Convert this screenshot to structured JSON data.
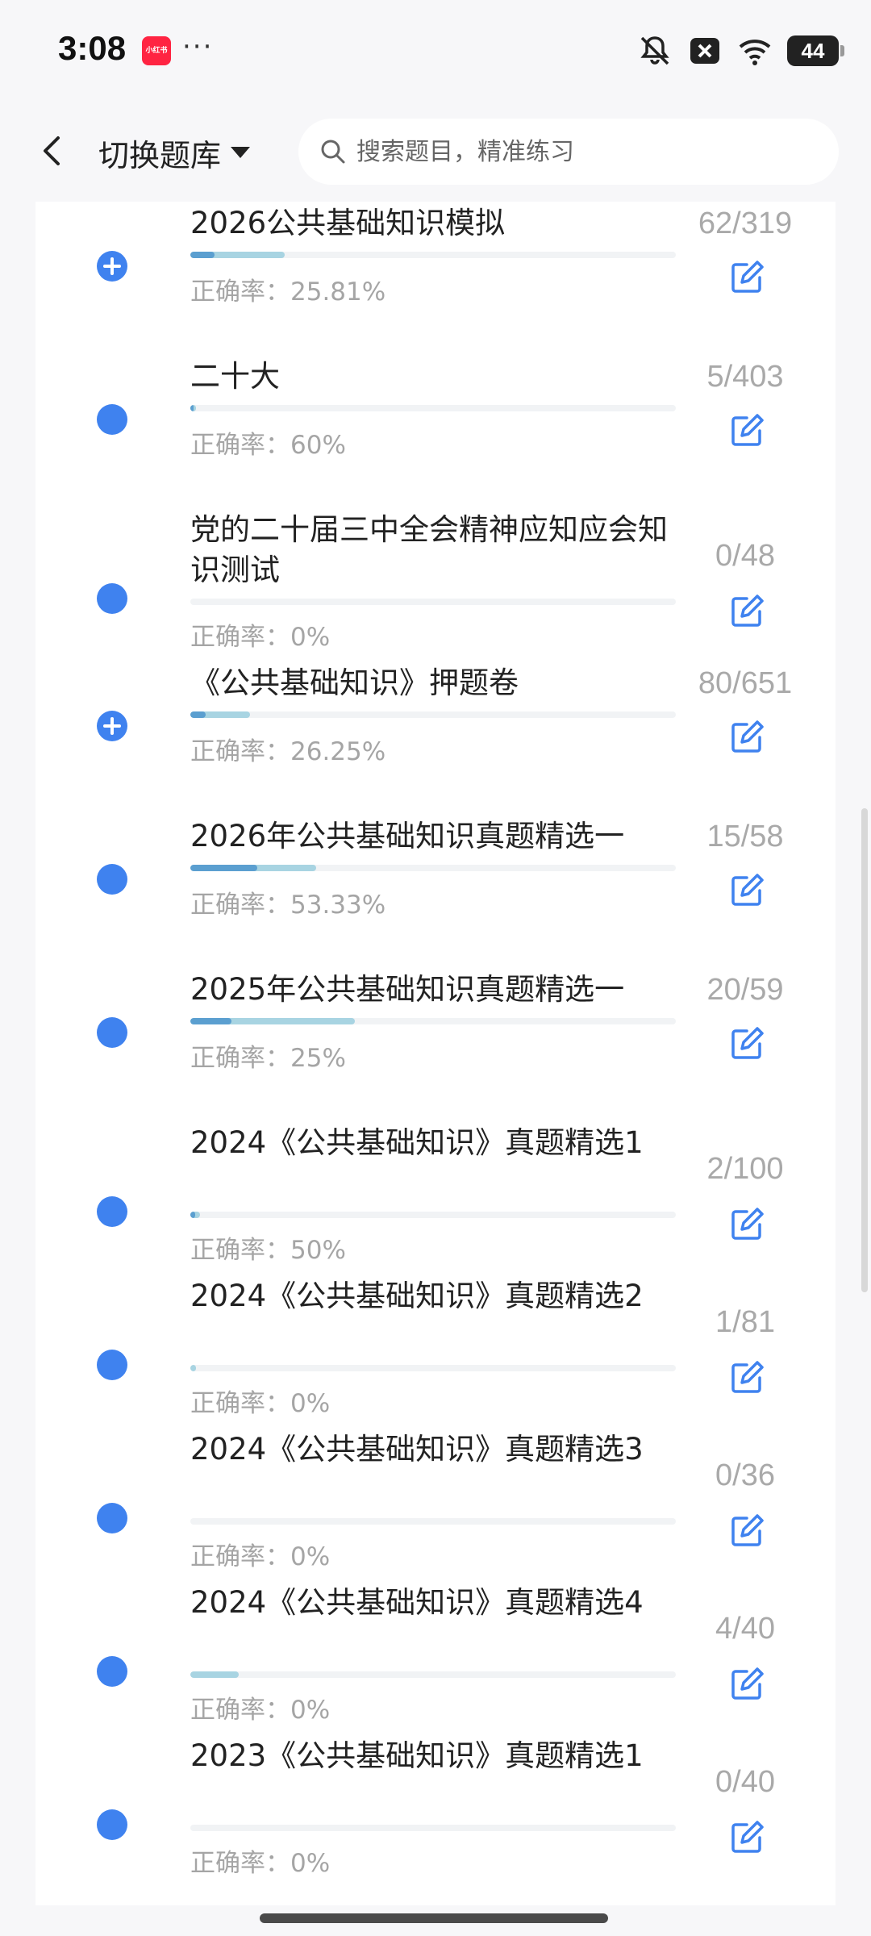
{
  "status_bar": {
    "time": "3:08",
    "app_badge": "小红书",
    "more_dots": "···",
    "battery": "44"
  },
  "header": {
    "switch_label": "切换题库",
    "search_placeholder": "搜索题目，精准练习"
  },
  "items": [
    {
      "title": "2026公共基础知识模拟",
      "rate_label": "正确率：25.81%",
      "count": "62/319",
      "progress": 0.194,
      "correct_share": 0.26,
      "icon": "plus-circle-icon"
    },
    {
      "title": "二十大",
      "rate_label": "正确率：60%",
      "count": "5/403",
      "progress": 0.012,
      "correct_share": 0.6,
      "icon": "dot"
    },
    {
      "title": "党的二十届三中全会精神应知应会知识测试",
      "rate_label": "正确率：0%",
      "count": "0/48",
      "progress": 0.0,
      "correct_share": 0.0,
      "icon": "dot"
    },
    {
      "title": "《公共基础知识》押题卷",
      "rate_label": "正确率：26.25%",
      "count": "80/651",
      "progress": 0.123,
      "correct_share": 0.26,
      "icon": "plus-circle-icon"
    },
    {
      "title": "2026年公共基础知识真题精选一",
      "rate_label": "正确率：53.33%",
      "count": "15/58",
      "progress": 0.259,
      "correct_share": 0.53,
      "icon": "dot"
    },
    {
      "title": "2025年公共基础知识真题精选一",
      "rate_label": "正确率：25%",
      "count": "20/59",
      "progress": 0.339,
      "correct_share": 0.25,
      "icon": "dot"
    },
    {
      "title": "2024《公共基础知识》真题精选1",
      "rate_label": "正确率：50%",
      "count": "2/100",
      "progress": 0.02,
      "correct_share": 0.5,
      "icon": "dot"
    },
    {
      "title": "2024《公共基础知识》真题精选2",
      "rate_label": "正确率：0%",
      "count": "1/81",
      "progress": 0.012,
      "correct_share": 0.0,
      "icon": "dot"
    },
    {
      "title": "2024《公共基础知识》真题精选3",
      "rate_label": "正确率：0%",
      "count": "0/36",
      "progress": 0.0,
      "correct_share": 0.0,
      "icon": "dot"
    },
    {
      "title": "2024《公共基础知识》真题精选4",
      "rate_label": "正确率：0%",
      "count": "4/40",
      "progress": 0.1,
      "correct_share": 0.0,
      "icon": "dot"
    },
    {
      "title": "2023《公共基础知识》真题精选1",
      "rate_label": "正确率：0%",
      "count": "0/40",
      "progress": 0.0,
      "correct_share": 0.0,
      "icon": "dot"
    }
  ],
  "colors": {
    "accent": "#3f82ef",
    "progress_done": "#a8d4e2",
    "progress_correct": "#5b9fd0",
    "muted_text": "#a5a5a5"
  }
}
